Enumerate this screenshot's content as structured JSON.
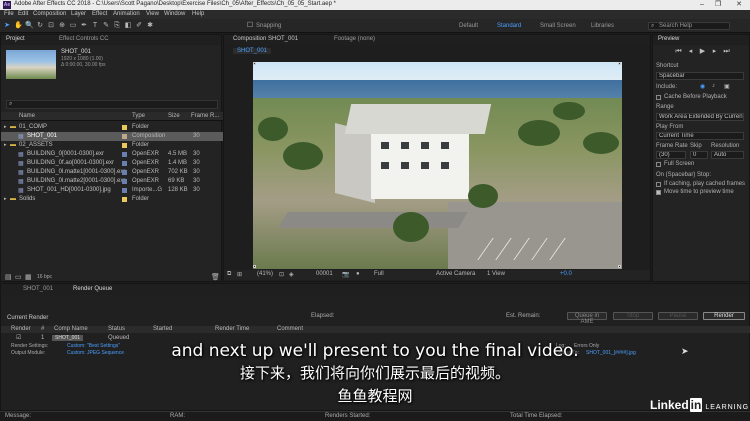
{
  "window": {
    "title": "Adobe After Effects CC 2018 - C:\\Users\\Scott Pagano\\Desktop\\Exercise Files\\Ch_05\\After_Effects\\Ch_05_05_Start.aep *",
    "app_icon": "Ae"
  },
  "menu": [
    "File",
    "Edit",
    "Composition",
    "Layer",
    "Effect",
    "Animation",
    "View",
    "Window",
    "Help"
  ],
  "toolbar": {
    "snapping": "Snapping",
    "workspaces": [
      "Default",
      "Standard",
      "Small Screen",
      "Libraries"
    ],
    "active_workspace": "Standard",
    "search_placeholder": "Search Help"
  },
  "project_panel": {
    "tab": "Project",
    "effects_tab": "Effect Controls CC",
    "selected_name": "SHOT_001",
    "selected_info1": "1920 x 1080 (1.00)",
    "selected_info2": "Δ 0:00:00, 30.00 fps",
    "columns": [
      "Name",
      "Type",
      "Size",
      "Frame R..."
    ],
    "rows": [
      {
        "name": "01_COMP",
        "type": "Folder",
        "size": "",
        "fps": "",
        "color": "#e8c95a",
        "indent": 0
      },
      {
        "name": "SHOT_001",
        "type": "Composition",
        "size": "",
        "fps": "30",
        "color": "#bfa98b",
        "indent": 1,
        "selected": true
      },
      {
        "name": "02_ASSETS",
        "type": "Folder",
        "size": "",
        "fps": "",
        "color": "#e8c95a",
        "indent": 0
      },
      {
        "name": "BUILDING_0[0001-0300].exr",
        "type": "OpenEXR",
        "size": "4.5 MB",
        "fps": "30",
        "color": "#6a7fb0",
        "indent": 1
      },
      {
        "name": "BUILDING_0f.ao[0001-0300].exr",
        "type": "OpenEXR",
        "size": "1.4 MB",
        "fps": "30",
        "color": "#6a7fb0",
        "indent": 1
      },
      {
        "name": "BUILDING_0l.matte1[0001-0300].exr",
        "type": "OpenEXR",
        "size": "702 KB",
        "fps": "30",
        "color": "#6a7fb0",
        "indent": 1
      },
      {
        "name": "BUILDING_0l.matte2[0001-0300].exr",
        "type": "OpenEXR",
        "size": "69 KB",
        "fps": "30",
        "color": "#6a7fb0",
        "indent": 1
      },
      {
        "name": "SHOT_001_HD[0001-0300].jpg",
        "type": "Importe...G",
        "size": "128 KB",
        "fps": "30",
        "color": "#6a7fb0",
        "indent": 1
      },
      {
        "name": "Solids",
        "type": "Folder",
        "size": "",
        "fps": "",
        "color": "#e8c95a",
        "indent": 0
      }
    ],
    "bpc": "16 bpc"
  },
  "composition_panel": {
    "tab_label": "Composition SHOT_001",
    "footage_tab": "Footage (none)",
    "subtab": "SHOT_001",
    "zoom": "(41%)",
    "timecode": "00001",
    "resolution": "Full",
    "camera": "Active Camera",
    "views": "1 View",
    "exposure": "+0.0"
  },
  "preview_panel": {
    "title": "Preview",
    "shortcut_label": "Shortcut",
    "shortcut_value": "Spacebar",
    "include_label": "Include:",
    "cache_label": "Cache Before Playback",
    "range_label": "Range",
    "range_value": "Work Area Extended By Current...",
    "play_from_label": "Play From",
    "play_from_value": "Current Time",
    "frame_rate_label": "Frame Rate",
    "skip_label": "Skip",
    "resolution_label": "Resolution",
    "frame_rate_value": "(30)",
    "skip_value": "0",
    "resolution_value": "Auto",
    "full_screen": "Full Screen",
    "stop_label": "On (Spacebar) Stop:",
    "stop_opt1": "If caching, play cached frames",
    "stop_opt2": "Move time to preview time"
  },
  "render_queue": {
    "tabs": [
      "SHOT_001",
      "Render Queue"
    ],
    "current_render": "Current Render",
    "elapsed": "Elapsed:",
    "est_remain": "Est. Remain:",
    "queue_in_ame": "Queue in AME",
    "stop": "Stop",
    "pause": "Pause",
    "render": "Render",
    "columns": [
      "Render",
      "#",
      "Comp Name",
      "Status",
      "Started",
      "Render Time",
      "Comment"
    ],
    "item": {
      "index": "1",
      "comp": "SHOT_001",
      "status": "Queued"
    },
    "render_settings_label": "Render Settings:",
    "render_settings_value": "Custom: \"Best Settings\"",
    "output_module_label": "Output Module:",
    "output_module_value": "Custom: JPEG Sequence",
    "log_label": "Log:",
    "log_value": "Errors Only",
    "output_to_label": "Output To:",
    "output_to_value": "SHOT_001_[####].jpg"
  },
  "status_bar": {
    "message": "Message:",
    "ram": "RAM:",
    "renders_started": "Renders Started:",
    "total_time": "Total Time Elapsed:"
  },
  "subtitles": {
    "english": "and next up we'll present to you the final video.",
    "chinese": "接下来，我们将向你们展示最后的视频。",
    "watermark": "鱼鱼教程网"
  },
  "branding": {
    "linked": "Linked",
    "in": "in",
    "learning": "LEARNING"
  }
}
